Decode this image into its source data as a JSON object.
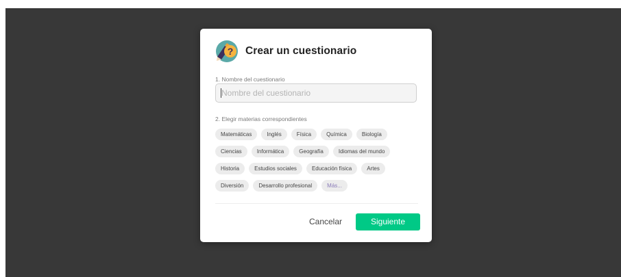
{
  "dialog": {
    "title": "Crear un cuestionario",
    "logo_icon": "question-mark-pencil-icon",
    "step1": {
      "label": "1. Nombre del cuestionario",
      "input_value": "",
      "input_placeholder": "Nombre del cuestionario"
    },
    "step2": {
      "label": "2. Elegir materias correspondientes",
      "subjects": [
        "Matemáticas",
        "Inglés",
        "Física",
        "Química",
        "Biología",
        "Ciencias",
        "Informática",
        "Geografía",
        "Idiomas del mundo",
        "Historia",
        "Estudios sociales",
        "Educación física",
        "Artes",
        "Diversión",
        "Desarrollo profesional"
      ],
      "more_label": "Más..."
    },
    "buttons": {
      "cancel": "Cancelar",
      "next": "Siguiente"
    }
  },
  "colors": {
    "backdrop": "#383838",
    "primary_button": "#00c986",
    "chip_background": "#ececec",
    "more_link": "#8a7bb8"
  }
}
